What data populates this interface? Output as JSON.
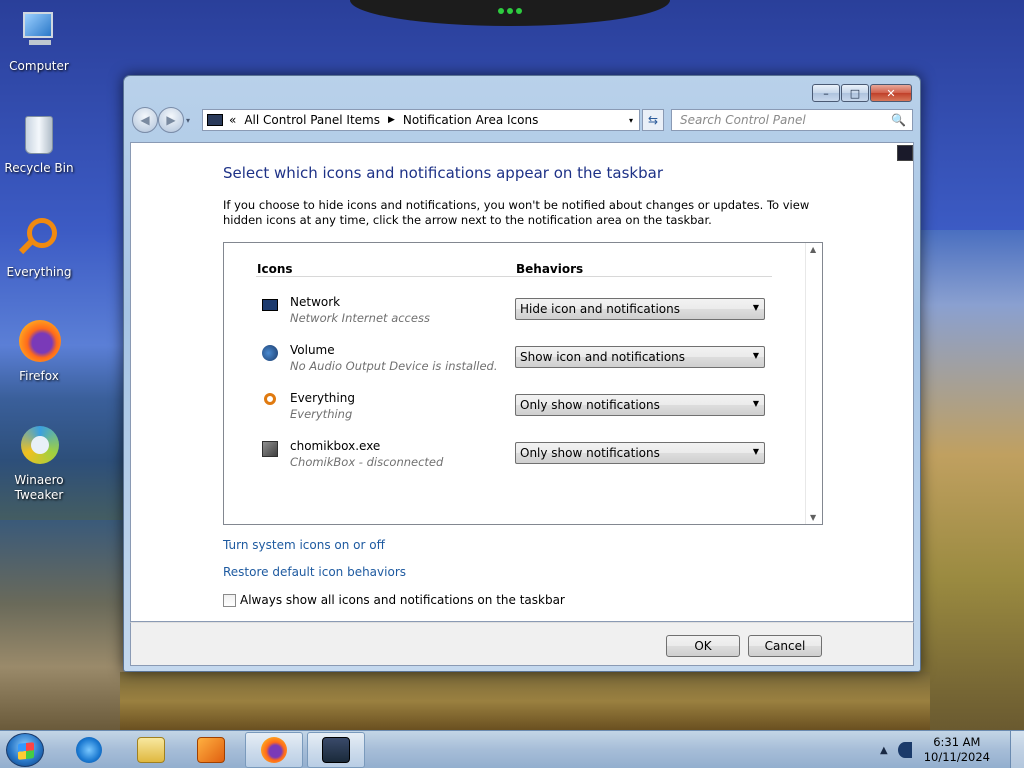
{
  "desktop": {
    "icons": [
      {
        "label": "Computer",
        "icon": "computer-icon"
      },
      {
        "label": "Recycle Bin",
        "icon": "recycle-bin-icon"
      },
      {
        "label": "Everything",
        "icon": "everything-icon"
      },
      {
        "label": "Firefox",
        "icon": "firefox-icon"
      },
      {
        "label": "Winaero\nTweaker",
        "icon": "winaero-tweaker-icon"
      }
    ]
  },
  "window": {
    "controls": {
      "minimize": "–",
      "maximize": "□",
      "close": "✕"
    },
    "nav": {
      "back": "◀",
      "forward": "▶",
      "dropdown": "▾"
    },
    "address": {
      "prefix": "«",
      "crumb1": "All Control Panel Items",
      "separator": "▶",
      "crumb2": "Notification Area Icons",
      "dropdown": "▾"
    },
    "refresh": "⇆",
    "search": {
      "placeholder": "Search Control Panel",
      "icon": "🔍"
    },
    "heading": "Select which icons and notifications appear on the taskbar",
    "description": "If you choose to hide icons and notifications, you won't be notified about changes or updates. To view hidden icons at any time, click the arrow next to the notification area on the taskbar.",
    "columns": {
      "icons": "Icons",
      "behaviors": "Behaviors"
    },
    "rows": [
      {
        "name": "Network",
        "desc": "Network Internet access",
        "behavior": "Hide icon and notifications",
        "icon": "network-icon",
        "color": "#1c3a6e"
      },
      {
        "name": "Volume",
        "desc": "No Audio Output Device is installed.",
        "behavior": "Show icon and notifications",
        "icon": "volume-icon",
        "color": "#1a4a8a"
      },
      {
        "name": "Everything",
        "desc": "Everything",
        "behavior": "Only show notifications",
        "icon": "everything-icon",
        "color": "#e07a10"
      },
      {
        "name": "chomikbox.exe",
        "desc": "ChomikBox - disconnected",
        "behavior": "Only show notifications",
        "icon": "chomikbox-icon",
        "color": "#505050"
      }
    ],
    "links": {
      "system_icons": "Turn system icons on or off",
      "restore": "Restore default icon behaviors"
    },
    "checkbox": {
      "label": "Always show all icons and notifications on the taskbar",
      "checked": false
    },
    "buttons": {
      "ok": "OK",
      "cancel": "Cancel"
    }
  },
  "taskbar": {
    "items": [
      "internet-explorer-icon",
      "file-explorer-icon",
      "media-player-icon",
      "firefox-icon",
      "control-panel-icon"
    ],
    "tray_chevron": "▲",
    "clock": {
      "time": "6:31 AM",
      "date": "10/11/2024"
    }
  }
}
